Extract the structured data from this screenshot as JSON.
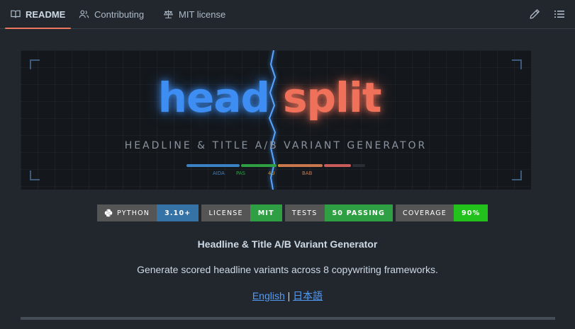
{
  "tabs": [
    {
      "label": "README",
      "icon": "book-icon",
      "active": true
    },
    {
      "label": "Contributing",
      "icon": "people-icon",
      "active": false
    },
    {
      "label": "MIT license",
      "icon": "law-icon",
      "active": false
    }
  ],
  "toolbar": {
    "edit_icon": "pencil-icon",
    "toc_icon": "list-icon"
  },
  "banner": {
    "logo_left": "head",
    "logo_right": "split",
    "tagline": "HEADLINE & TITLE A/B VARIANT GENERATOR",
    "frameworks": [
      {
        "label": "AIDA",
        "color": "#3b82c4"
      },
      {
        "label": "PAS",
        "color": "#2ea043"
      },
      {
        "label": "4U",
        "color": "#d29922"
      },
      {
        "label": "BAB",
        "color": "#c8774d"
      },
      {
        "label": "",
        "color": "#c95b5b"
      }
    ],
    "colors": {
      "left": "#3d8df2",
      "right": "#f0715a"
    }
  },
  "badges": [
    {
      "key": "PYTHON",
      "value": "3.10+",
      "color": "#3572a5",
      "icon": "python-icon"
    },
    {
      "key": "LICENSE",
      "value": "MIT",
      "color": "#2ea043"
    },
    {
      "key": "TESTS",
      "value": "50 PASSING",
      "color": "#2ea043"
    },
    {
      "key": "COVERAGE",
      "value": "90%",
      "color": "#22c11c"
    }
  ],
  "content": {
    "title": "Headline & Title A/B Variant Generator",
    "description": "Generate scored headline variants across 8 copywriting frameworks.",
    "lang_en": "English",
    "lang_sep": "|",
    "lang_ja": "日本語"
  }
}
